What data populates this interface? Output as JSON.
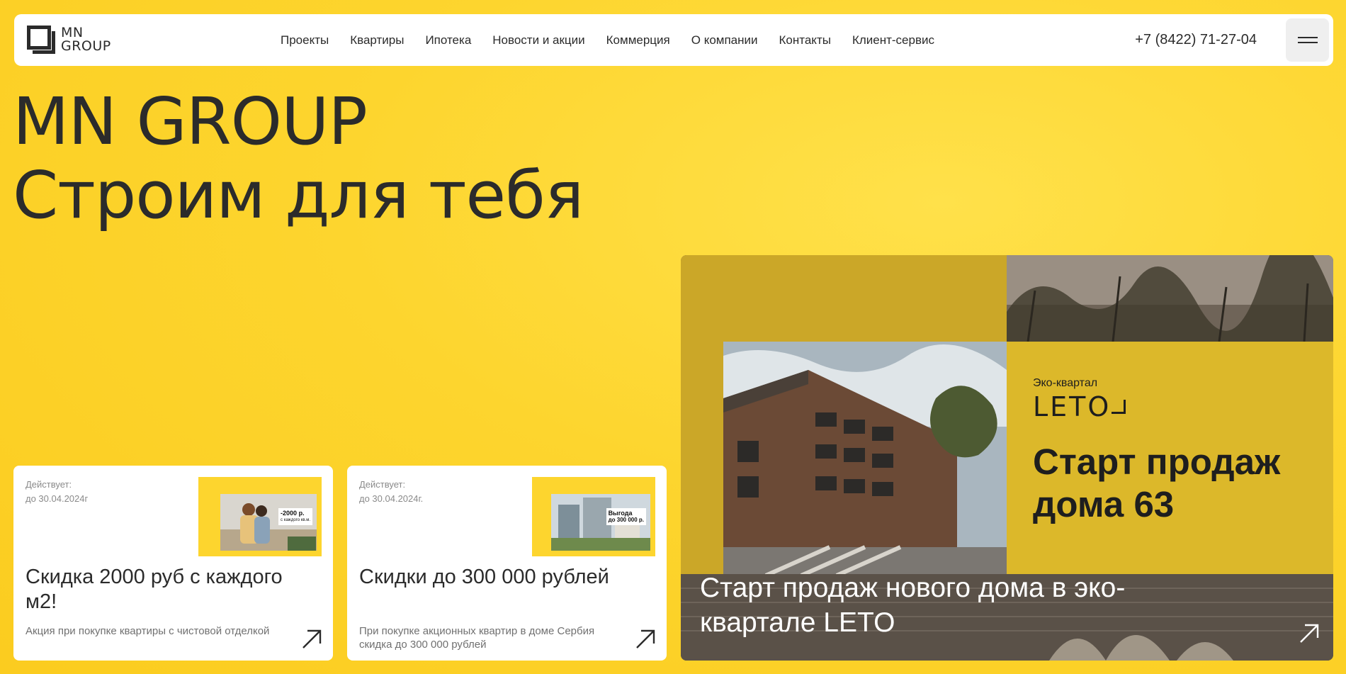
{
  "header": {
    "logo_line1": "MN",
    "logo_line2": "GROUP",
    "nav": [
      "Проекты",
      "Квартиры",
      "Ипотека",
      "Новости и акции",
      "Коммерция",
      "О компании",
      "Контакты",
      "Клиент-сервис"
    ],
    "phone": "+7 (8422) 71-27-04",
    "menu_icon": "hamburger-icon"
  },
  "hero": {
    "title_line1": "MN GROUP",
    "title_line2": "Строим для тебя"
  },
  "promos": [
    {
      "valid_label": "Действует:",
      "valid_date": "до 30.04.2024г",
      "thumb_text": "-2000 р.",
      "thumb_subtext": "с каждого кв.м.",
      "title": "Скидка 2000 руб с каждого м2!",
      "desc": "Акция при покупке квартиры с чистовой отделкой",
      "arrow_icon": "arrow-up-right-icon"
    },
    {
      "valid_label": "Действует:",
      "valid_date": "до 30.04.2024г.",
      "thumb_text": "Выгода",
      "thumb_subtext": "до 300 000 р.",
      "title": "Скидки до 300 000 рублей",
      "desc": "При покупке акционных квартир в доме Сербия скидка до 300 000 рублей",
      "arrow_icon": "arrow-up-right-icon"
    }
  ],
  "banner": {
    "eco_label": "Эко-квартал",
    "brand": "LETO",
    "sale_title": "Старт продаж дома 63",
    "caption": "Старт продаж нового дома в эко-квартале LETO",
    "arrow_icon": "arrow-up-right-icon"
  },
  "colors": {
    "background": "#fdd52e",
    "text": "#2b2b2b",
    "card": "#ffffff",
    "banner_yellow": "#dcb82a"
  }
}
